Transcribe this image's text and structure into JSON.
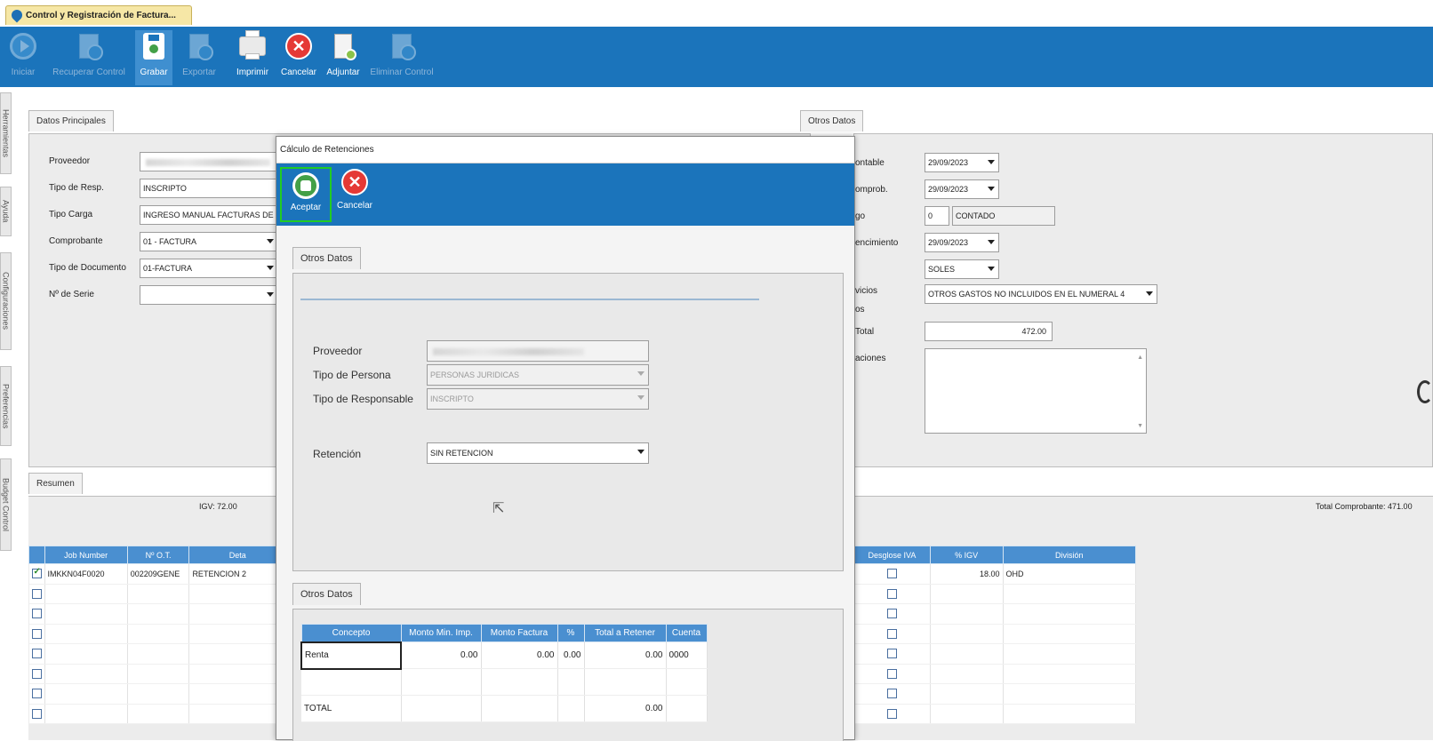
{
  "window_tab": {
    "title": "Control y Registración de Factura..."
  },
  "toolbar": {
    "buttons": [
      {
        "label": "Iniciar",
        "icon": "play-icon",
        "enabled": false
      },
      {
        "label": "Recuperar Control",
        "icon": "recover-document-icon",
        "enabled": false
      },
      {
        "label": "Grabar",
        "icon": "save-icon",
        "enabled": true
      },
      {
        "label": "Exportar",
        "icon": "export-document-icon",
        "enabled": false
      },
      {
        "label": "Imprimir",
        "icon": "printer-icon",
        "enabled": true
      },
      {
        "label": "Cancelar",
        "icon": "cancel-icon",
        "enabled": true
      },
      {
        "label": "Adjuntar",
        "icon": "attach-document-icon",
        "enabled": true
      },
      {
        "label": "Eliminar Control",
        "icon": "delete-document-icon",
        "enabled": false
      }
    ]
  },
  "sidebar_tabs": [
    "Herramientas",
    "Ayuda",
    "Configuraciones",
    "Preferencias",
    "Budget Control"
  ],
  "datos_principales": {
    "tab_label": "Datos Principales",
    "fields": {
      "proveedor_label": "Proveedor",
      "tipo_resp_label": "Tipo de Resp.",
      "tipo_resp_value": "INSCRIPTO",
      "tipo_carga_label": "Tipo Carga",
      "tipo_carga_value": "INGRESO MANUAL FACTURAS DE P",
      "comprobante_label": "Comprobante",
      "comprobante_value": "01 - FACTURA",
      "tipo_documento_label": "Tipo de Documento",
      "tipo_documento_value": "01-FACTURA",
      "serie_label": "Nº de Serie",
      "serie_value": ""
    }
  },
  "otros_datos_bg": {
    "tab_label": "Otros Datos",
    "fields": {
      "contable_label": "ontable",
      "contable_value": "29/09/2023",
      "comprob_label": "omprob.",
      "comprob_value": "29/09/2023",
      "pago_label": "go",
      "pago_code": "0",
      "pago_value": "CONTADO",
      "vencimiento_label": "encimiento",
      "vencimiento_value": "29/09/2023",
      "moneda_value": "SOLES",
      "servicios_label_1": "vicios",
      "servicios_label_2": "os",
      "servicios_value": "OTROS GASTOS NO INCLUIDOS EN EL NUMERAL 4",
      "total_label": "Total",
      "total_value": "472.00",
      "observaciones_label": "aciones",
      "observaciones_value": ""
    }
  },
  "resumen": {
    "tab_label": "Resumen",
    "igv_text": "IGV: 72.00",
    "total_text": "Total Comprobante: 471.00"
  },
  "grid": {
    "left_columns": [
      "Job Number",
      "Nº O.T.",
      "Deta"
    ],
    "right_columns": [
      "Desglose IVA",
      "% IGV",
      "División"
    ],
    "rows": [
      {
        "checked": true,
        "job": "IMKKN04F0020",
        "ot": "002209GENE",
        "detalle": "RETENCION 2",
        "desglose": false,
        "igv": "18.00",
        "division": "OHD"
      },
      {
        "checked": false,
        "job": "",
        "ot": "",
        "detalle": "",
        "desglose": false,
        "igv": "",
        "division": ""
      },
      {
        "checked": false,
        "job": "",
        "ot": "",
        "detalle": "",
        "desglose": false,
        "igv": "",
        "division": ""
      },
      {
        "checked": false,
        "job": "",
        "ot": "",
        "detalle": "",
        "desglose": false,
        "igv": "",
        "division": ""
      },
      {
        "checked": false,
        "job": "",
        "ot": "",
        "detalle": "",
        "desglose": false,
        "igv": "",
        "division": ""
      },
      {
        "checked": false,
        "job": "",
        "ot": "",
        "detalle": "",
        "desglose": false,
        "igv": "",
        "division": ""
      },
      {
        "checked": false,
        "job": "",
        "ot": "",
        "detalle": "",
        "desglose": false,
        "igv": "",
        "division": ""
      },
      {
        "checked": false,
        "job": "",
        "ot": "",
        "detalle": "",
        "desglose": false,
        "igv": "",
        "division": ""
      },
      {
        "checked": false,
        "job": "",
        "ot": "",
        "detalle": "",
        "desglose": false,
        "igv": "",
        "division": ""
      }
    ]
  },
  "modal": {
    "title": "Cálculo de Retenciones",
    "accept_label": "Aceptar",
    "cancel_label": "Cancelar",
    "section1_tab": "Otros Datos",
    "proveedor_label": "Proveedor",
    "tipo_persona_label": "Tipo de Persona",
    "tipo_persona_value": "PERSONAS JURIDICAS",
    "tipo_responsable_label": "Tipo de Responsable",
    "tipo_responsable_value": "INSCRIPTO",
    "retencion_label": "Retención",
    "retencion_value": "SIN RETENCION",
    "section2_tab": "Otros Datos",
    "table": {
      "columns": [
        "Concepto",
        "Monto Min. Imp.",
        "Monto Factura",
        "%",
        "Total a Retener",
        "Cuenta"
      ],
      "rows": [
        {
          "concepto": "Renta",
          "monto_min": "0.00",
          "monto_factura": "0.00",
          "pct": "0.00",
          "total": "0.00",
          "cuenta": "0000"
        },
        {
          "concepto": "",
          "monto_min": "",
          "monto_factura": "",
          "pct": "",
          "total": "",
          "cuenta": ""
        },
        {
          "concepto": "TOTAL",
          "monto_min": "",
          "monto_factura": "",
          "pct": "",
          "total": "0.00",
          "cuenta": ""
        }
      ]
    }
  },
  "colors": {
    "toolbar_blue": "#1b74bb",
    "grid_header_blue": "#4a8fd0",
    "accept_highlight": "#22cc22",
    "cancel_red": "#e53935",
    "accept_green": "#43a047"
  }
}
